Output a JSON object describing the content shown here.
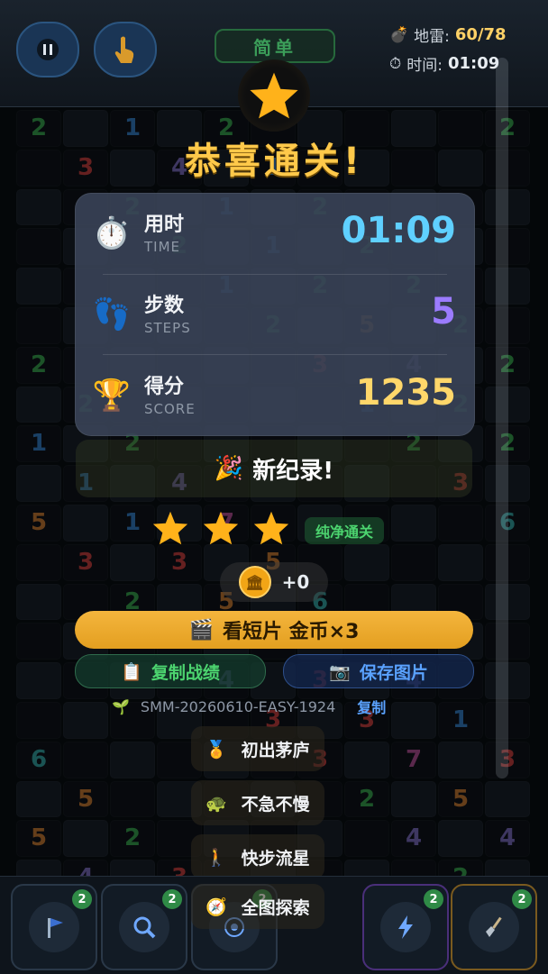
{
  "header": {
    "difficulty": "简单",
    "mines_label": "地雷:",
    "mines_value": "60/78",
    "time_label": "时间:",
    "time_value": "01:09"
  },
  "result": {
    "title": "恭喜通关!",
    "stats": [
      {
        "label": "用时",
        "sub": "TIME",
        "value": "01:09",
        "color": "#5fd0ff"
      },
      {
        "label": "步数",
        "sub": "STEPS",
        "value": "5",
        "color": "#9b7bff"
      },
      {
        "label": "得分",
        "sub": "SCORE",
        "value": "1235",
        "color": "#ffd76a"
      }
    ],
    "new_record": "新纪录!",
    "stars": 3,
    "pure_clear": "纯净通关",
    "coins_gained": "+0",
    "watch_button": "看短片 金币×3",
    "copy_button": "复制战绩",
    "save_button": "保存图片",
    "seed": "SMM-20260610-EASY-1924",
    "seed_copy": "复制",
    "achievements": [
      "初出茅庐",
      "不急不慢",
      "快步流星",
      "全图探索"
    ]
  },
  "tools": [
    {
      "icon": "flag-icon",
      "count": "2"
    },
    {
      "icon": "magnifier-icon",
      "count": "2"
    },
    {
      "icon": "target-icon",
      "count": "2"
    },
    {
      "icon": "lightning-icon",
      "count": "2"
    },
    {
      "icon": "shovel-icon",
      "count": "2"
    }
  ],
  "board_numbers": [
    "2",
    "1",
    "2",
    "2",
    "3",
    "4",
    "1",
    "2",
    "1",
    "2",
    "2",
    "1",
    "2",
    "1",
    "2",
    "2",
    "2",
    "5",
    "2",
    "2",
    "3",
    "4",
    "2",
    "2",
    "1",
    "2",
    "1",
    "2",
    "2",
    "2",
    "1",
    "4",
    "3",
    "5",
    "1",
    "7",
    "6",
    "3",
    "3",
    "5",
    "2",
    "5",
    "6",
    "4",
    "5",
    "4",
    "4",
    "3",
    "4",
    "3",
    "3",
    "1",
    "6",
    "3",
    "7",
    "3",
    "5",
    "2",
    "5",
    "5",
    "2",
    "4",
    "4",
    "4",
    "3",
    "2",
    "1",
    "2",
    "2",
    "1"
  ]
}
